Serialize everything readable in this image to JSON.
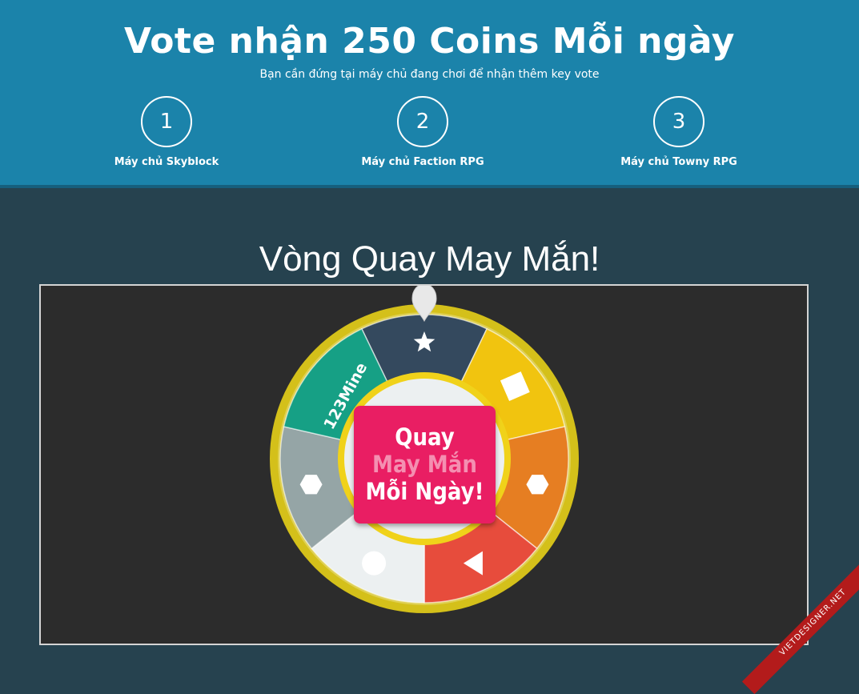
{
  "header": {
    "title": "Vote nhận 250 Coins Mỗi ngày",
    "subtitle": "Bạn cần đứng tại máy chủ đang chơi để nhận thêm key vote",
    "steps": [
      {
        "number": "1",
        "label": "Máy chủ Skyblock"
      },
      {
        "number": "2",
        "label": "Máy chủ Faction RPG"
      },
      {
        "number": "3",
        "label": "Máy chủ Towny RPG"
      }
    ]
  },
  "wheel": {
    "title": "Vòng Quay May Mắn!",
    "segments": [
      {
        "color": "#34495e",
        "icon": "star-icon"
      },
      {
        "color": "#f1c40f",
        "icon": "square-icon"
      },
      {
        "color": "#e67e22",
        "icon": "hexagon-icon"
      },
      {
        "color": "#e74c3c",
        "icon": "triangle-icon"
      },
      {
        "color": "#ecf0f1",
        "icon": "circle-icon"
      },
      {
        "color": "#95a5a6",
        "icon": "hexagon-icon"
      },
      {
        "color": "#16a085",
        "text": "123Mine"
      }
    ],
    "rim_color": "#d4c01a",
    "spin_button": {
      "line1": "Quay",
      "line2": "May Mắn",
      "line3": "Mỗi Ngày!",
      "color": "#e91e63"
    }
  },
  "watermark": "VIETDESIGNER.NET"
}
